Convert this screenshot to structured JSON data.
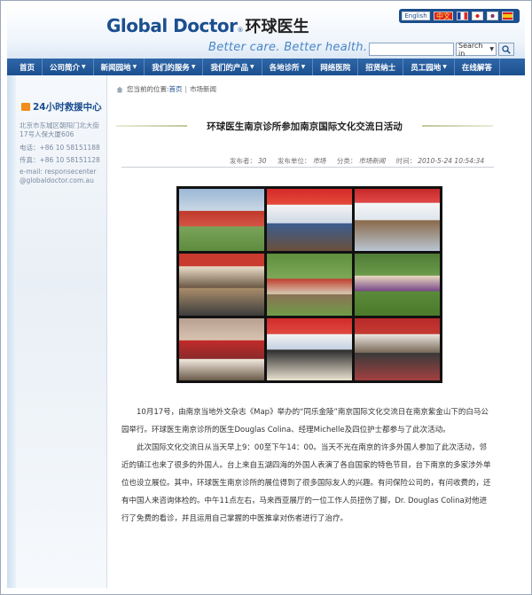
{
  "header": {
    "logo_en": "Global Doctor",
    "logo_reg": "®",
    "logo_cn": "环球医生",
    "slogan": "Better care. Better health.",
    "languages": {
      "english": "English",
      "chinese": "中文"
    },
    "search": {
      "input_value": "",
      "select_value": "Search in"
    }
  },
  "nav": {
    "items": [
      {
        "label": "首页",
        "dropdown": false
      },
      {
        "label": "公司简介",
        "dropdown": true
      },
      {
        "label": "新闻园地",
        "dropdown": true
      },
      {
        "label": "我们的服务",
        "dropdown": true
      },
      {
        "label": "我们的产品",
        "dropdown": true
      },
      {
        "label": "各地诊所",
        "dropdown": true
      },
      {
        "label": "网络医院",
        "dropdown": false
      },
      {
        "label": "招贤纳士",
        "dropdown": false
      },
      {
        "label": "员工园地",
        "dropdown": true
      },
      {
        "label": "在线解答",
        "dropdown": false
      }
    ]
  },
  "sidebar": {
    "title": "24小时救援中心",
    "address": "北京市东城区朝阳门北大街17号人保大厦606",
    "phone_label": "电话：",
    "phone": "+86 10 58151188",
    "fax_label": "传真：",
    "fax": "+86 10 58151128",
    "email_label": "e-mail: responsecenter",
    "email_domain": "@globaldoctor.com.au"
  },
  "breadcrumb": {
    "prefix": "您当前的位置:",
    "home": "首页",
    "separator": "|",
    "current": "市场新闻"
  },
  "article": {
    "title": "环球医生南京诊所参加南京国际文化交流日活动",
    "meta": {
      "publisher_label": "发布者：",
      "publisher": "30",
      "unit_label": "发布单位：",
      "unit": "市场",
      "category_label": "分类：",
      "category": "市场新闻",
      "time_label": "时间：",
      "time": "2010-5-24 10:54:34"
    },
    "paragraphs": [
      "10月17号，由南京当地外文杂志《Map》举办的“同乐金陵”南京国际文化交流日在南京紫金山下的白马公园举行。环球医生南京诊所的医生Douglas Colina、经理Michelle及四位护士都参与了此次活动。",
      "此次国际文化交流日从当天早上9：00至下午14：00。当天不光在南京的许多外国人参加了此次活动，邻近的镇江也来了很多的外国人。台上来自五湖四海的外国人表演了各自国家的特色节目，台下南京的多家涉外单位也设立展位。其中，环球医生南京诊所的展位得到了很多国际友人的兴趣。有问保险公司的，有问收费的，还有中国人来咨询体检的。中午11点左右，马来西亚展厅的一位工作人员扭伤了脚，Dr. Douglas Colina对他进行了免费的看诊，并且运用自己掌握的中医推拿对伤者进行了治疗。"
    ]
  },
  "colors": {
    "brand_blue": "#1b4f8f",
    "accent_orange": "#f28c1b"
  }
}
